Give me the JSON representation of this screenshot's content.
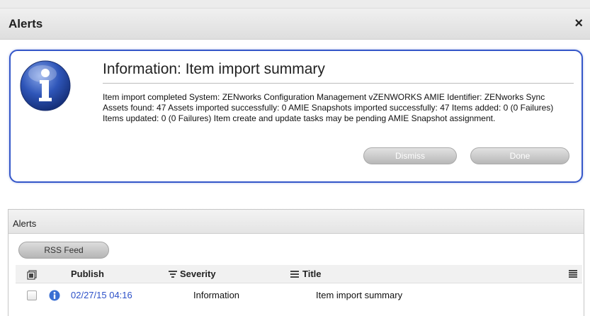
{
  "dialog": {
    "title": "Alerts",
    "close_symbol": "×"
  },
  "info": {
    "icon": "information-icon",
    "heading": "Information: Item import summary",
    "message": "Item import completed System: ZENworks Configuration Management vZENWORKS AMIE Identifier: ZENworks Sync Assets found: 47 Assets imported successfully: 0 AMIE Snapshots imported successfully: 47 Items added: 0 (0 Failures) Items updated: 0 (0 Failures) Item create and update tasks may be pending AMIE Snapshot assignment.",
    "dismiss_label": "Dismiss",
    "done_label": "Done"
  },
  "alerts_panel": {
    "title": "Alerts",
    "rss_label": "RSS Feed",
    "columns": {
      "publish": "Publish",
      "severity": "Severity",
      "title": "Title"
    },
    "rows": [
      {
        "publish": "02/27/15 04:16",
        "severity": "Information",
        "title": "Item import summary"
      }
    ]
  },
  "colors": {
    "accent_border": "#3557c9",
    "link": "#2c50c8"
  }
}
